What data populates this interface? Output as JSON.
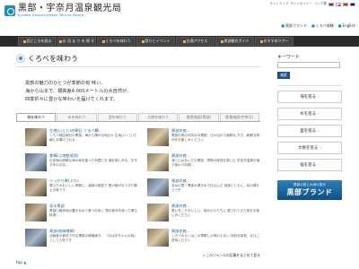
{
  "top_links": {
    "items": [
      "サイトマップ",
      "サイトポリシー",
      "リンク集"
    ]
  },
  "logo": {
    "ja": "黒部・宇奈月温泉観光局",
    "en": "Kurobe Unazukionsen Tourist Board"
  },
  "util": {
    "items": [
      "黒部ブランド",
      "くろべ体験",
      "English"
    ]
  },
  "nav": {
    "items": [
      "見どころを巡る",
      "お 泊 ま り を 探 す",
      "くろべを味わう",
      "祭りとイベント",
      "交通アクセス",
      "黒部観光ガイド",
      "おすすめツアー"
    ]
  },
  "main": {
    "title": "くろべを味わう",
    "lead": [
      "黒部の魅力のひとつが季節の旬 味い。",
      "海から山まで、標高差4,000メートルの大自然が、",
      "四季折々に豊かな味わいを届けてくれます。"
    ],
    "tabs": [
      "海を味わう",
      "水を味わう",
      "里を味わう",
      "大地を味わう",
      "飲食施設(黒部)",
      "飲食施設(宇奈月)"
    ],
    "items": [
      {
        "title": "生地(いくじ)の朝日 くろべ鯛...",
        "desc": "くろべ地区朝日の黒部、海から揚がる地元の 生地(いくじ)で朝に水揚げされる..."
      },
      {
        "title": "黒部の夜...",
        "desc": "黒部の夜の宇奈月の黒部、日の出から新鮮な 夕方、新鮮な寿司をお楽しみください"
      },
      {
        "title": "食輝(ぶ地産地消)",
        "desc": "日本海の新鮮な海の幸を使った料理とお 酒を楽しめる、おすすめのお店..."
      },
      {
        "title": "黒部の夜...",
        "desc": "海と山のあいだの黒部、季節の味覚を楽しむ 宇奈月温泉の宿で味わう料理..."
      },
      {
        "title": "べっかり煮(ぶり)",
        "desc": "寒ぶりのおいしい季節に、漁師の家庭で 受け継がれてきた郷土の味です"
      },
      {
        "title": "黒部の夜...",
        "desc": "名水の里・黒部の湧き水で仕込んだ 地酒とともに、旬の肴をどうぞ"
      },
      {
        "title": "見る黒部",
        "desc": "黒部川扇状地の豊かな水で育つお米と 里の恵みを使った郷土料理..."
      },
      {
        "title": "黒部の夜...",
        "desc": "寒い冬こそおいしい、地元の人たちに 愛されてきた味をお楽しみください"
      },
      {
        "title": "黒部(肉味噌焼)",
        "desc": "北陸産の食材で作る黒部の味噌焼き、 「おばあちゃんの味」として人気です"
      },
      {
        "title": "黒部の夜...",
        "desc": "くろべのカニはこの季節しか味わえない 特別な味覚、ぜひご賞味ください"
      }
    ],
    "more_link": "このジャンルの記事をまとめて見る",
    "page_top": "top"
  },
  "sidebar": {
    "keyword_label": "キーワード",
    "keyword_placeholder": "",
    "search_label": "検索",
    "buttons": [
      "海を巡る",
      "水を巡る",
      "里を巡る",
      "大地を巡る",
      "宿を巡る"
    ],
    "banner_top": "黒部の風と大地の恵み",
    "banner_big": "黒部ブランド"
  },
  "colors": {
    "nav_bg": "#2b2b2b",
    "accent": "#1a8fb3",
    "link": "#1a5a8f",
    "banner": "#1f5f9a"
  }
}
